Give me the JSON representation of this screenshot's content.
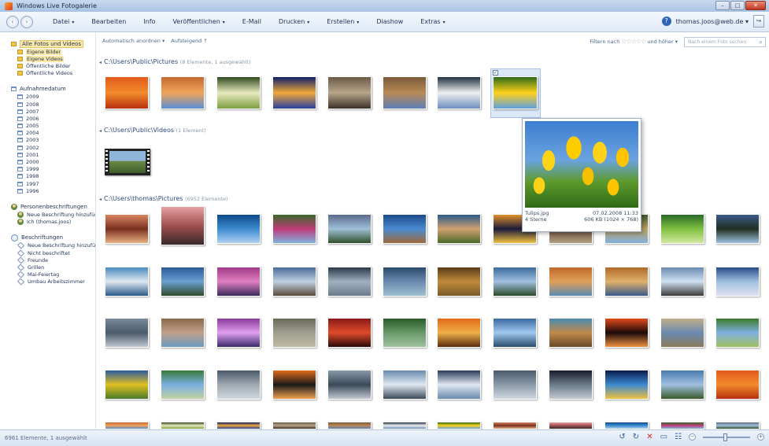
{
  "window": {
    "title": "Windows Live Fotogalerie"
  },
  "menu": {
    "items": [
      "Datei",
      "Bearbeiten",
      "Info",
      "Veröffentlichen",
      "E-Mail",
      "Drucken",
      "Erstellen",
      "Diashow",
      "Extras"
    ],
    "dropdown_flags": [
      true,
      false,
      false,
      true,
      false,
      true,
      true,
      false,
      true
    ],
    "account": "thomas.joos@web.de"
  },
  "toolbar": {
    "arrange": "Automatisch anordnen",
    "sort": "Aufsteigend",
    "filter_label": "Filtern nach",
    "filter_suffix": "und höher",
    "search_placeholder": "Nach einem Foto suchen"
  },
  "sidebar": {
    "all_label": "Alle Fotos und Videos",
    "folders": [
      "Eigene Bilder",
      "Eigene Videos",
      "Öffentliche Bilder",
      "Öffentliche Videos"
    ],
    "date_label": "Aufnahmedatum",
    "years": [
      "2009",
      "2008",
      "2007",
      "2006",
      "2005",
      "2004",
      "2003",
      "2002",
      "2001",
      "2000",
      "1999",
      "1998",
      "1997",
      "1996"
    ],
    "people_label": "Personenbeschriftungen",
    "people": [
      "Neue Beschriftung hinzufüg",
      "Ich (thomas.joos)"
    ],
    "tags_label": "Beschriftungen",
    "tags": [
      "Neue Beschriftung hinzufüg",
      "Nicht beschriftet",
      "Freunde",
      "Grillen",
      "Mai-Feiertag",
      "Umbau Arbeitszimmer"
    ]
  },
  "groups": [
    {
      "path": "C:\\Users\\Public\\Pictures",
      "count": "(8 Elemente, 1 ausgewählt)"
    },
    {
      "path": "C:\\Users\\Public\\Videos",
      "count": "(1 Element)"
    },
    {
      "path": "C:\\Users\\thomas\\Pictures",
      "count": "(6952 Elemente)"
    }
  ],
  "preview": {
    "filename": "Tulips.jpg",
    "date": "07.02.2008 11:33",
    "rating": "4 Sterne",
    "size": "606 KB (1024 × 768)"
  },
  "status": {
    "text": "6961 Elemente, 1 ausgewählt"
  },
  "colors": {
    "accent": "#2e64b8",
    "selection": "#fbe7a7",
    "delete": "#d02a20"
  }
}
